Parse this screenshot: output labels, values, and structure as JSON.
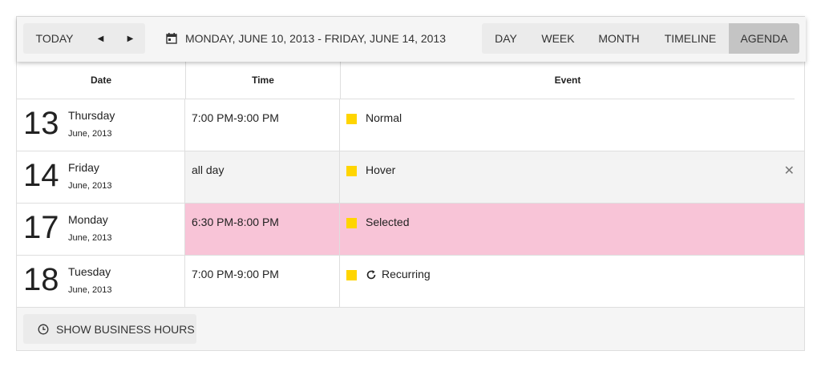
{
  "toolbar": {
    "today_label": "TODAY",
    "prev_icon": "caret-left-icon",
    "next_icon": "caret-right-icon",
    "date_range": "MONDAY, JUNE 10, 2013 - FRIDAY, JUNE 14, 2013",
    "views": [
      {
        "label": "DAY",
        "active": false
      },
      {
        "label": "WEEK",
        "active": false
      },
      {
        "label": "MONTH",
        "active": false
      },
      {
        "label": "TIMELINE",
        "active": false
      },
      {
        "label": "AGENDA",
        "active": true
      }
    ]
  },
  "columns": {
    "date": "Date",
    "time": "Time",
    "event": "Event"
  },
  "rows": [
    {
      "day": "13",
      "weekday": "Thursday",
      "month": "June, 2013",
      "time": "7:00 PM-9:00 PM",
      "title": "Normal",
      "state": "normal"
    },
    {
      "day": "14",
      "weekday": "Friday",
      "month": "June, 2013",
      "time": "all day",
      "title": "Hover",
      "state": "hover"
    },
    {
      "day": "17",
      "weekday": "Monday",
      "month": "June, 2013",
      "time": "6:30 PM-8:00 PM",
      "title": "Selected",
      "state": "selected"
    },
    {
      "day": "18",
      "weekday": "Tuesday",
      "month": "June, 2013",
      "time": "7:00 PM-9:00 PM",
      "title": "Recurring",
      "state": "recurring"
    }
  ],
  "footer": {
    "business_hours_label": "SHOW BUSINESS HOURS"
  },
  "colors": {
    "event_marker": "#ffd500",
    "selected_bg": "#f8c4d7",
    "hover_bg": "#f3f3f3",
    "active_view_bg": "#c4c4c4"
  }
}
